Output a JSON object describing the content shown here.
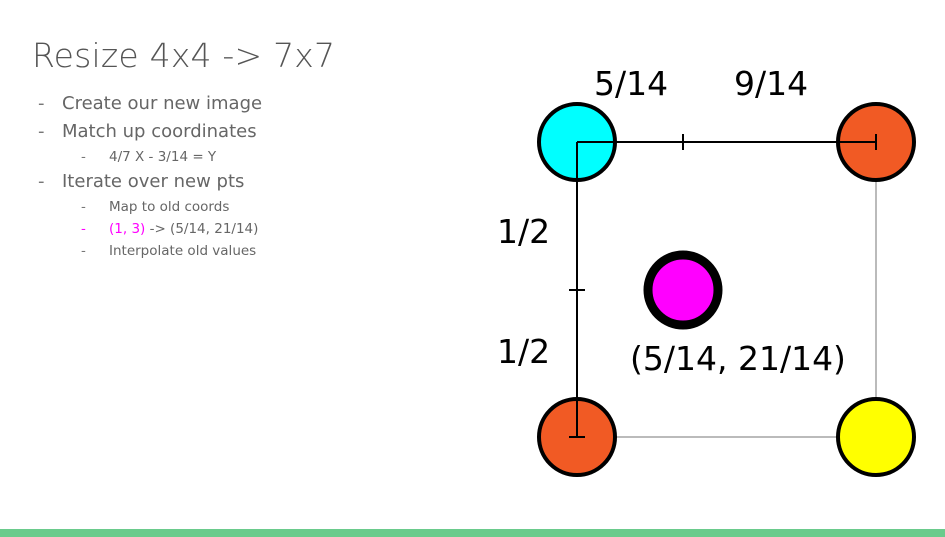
{
  "slide": {
    "title": "Resize 4x4 -> 7x7",
    "bullets": [
      {
        "text": "Create our new image"
      },
      {
        "text": "Match up coordinates",
        "sub": [
          {
            "text": "4/7 X - 3/14 = Y"
          }
        ]
      },
      {
        "text": "Iterate over new pts",
        "sub": [
          {
            "text": "Map to old coords"
          },
          {
            "highlight": "(1, 3)",
            "text": " -> (5/14, 21/14)"
          },
          {
            "text": "Interpolate old values"
          }
        ]
      }
    ]
  },
  "diagram": {
    "labels": {
      "top_left": "5/14",
      "top_right": "9/14",
      "left_upper": "1/2",
      "left_lower": "1/2",
      "point": "(5/14, 21/14)"
    },
    "colors": {
      "top_left_pixel": "#00ffff",
      "top_right_pixel": "#f15a24",
      "bottom_left_pixel": "#f15a24",
      "bottom_right_pixel": "#ffff00",
      "new_point": "#ff00ff",
      "accent_bar": "#6acb8c"
    }
  }
}
